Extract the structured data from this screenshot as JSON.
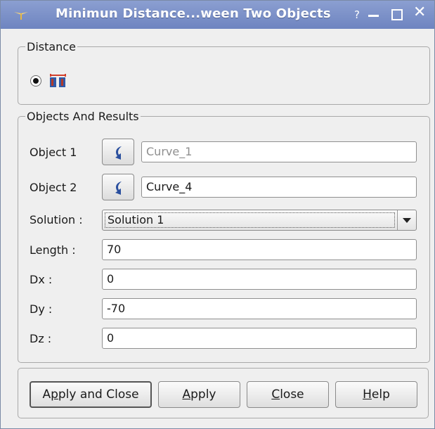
{
  "window": {
    "title": "Minimun Distance...ween Two Objects",
    "help_glyph": "?",
    "close_glyph": "✕"
  },
  "distance_group": {
    "label": "Distance",
    "option_icon": "two-objects-distance-icon"
  },
  "objects_group": {
    "label": "Objects And Results",
    "object1": {
      "label": "Object 1",
      "value": "Curve_1"
    },
    "object2": {
      "label": "Object 2",
      "value": "Curve_4"
    },
    "solution": {
      "label": "Solution :",
      "selected": "Solution 1"
    },
    "length": {
      "label": "Length :",
      "value": "70"
    },
    "dx": {
      "label": "Dx :",
      "value": "0"
    },
    "dy": {
      "label": "Dy :",
      "value": "-70"
    },
    "dz": {
      "label": "Dz :",
      "value": "0"
    }
  },
  "buttons": {
    "apply_close": {
      "pre": "A",
      "mn": "p",
      "post": "ply and Close"
    },
    "apply": {
      "pre": "",
      "mn": "A",
      "post": "pply"
    },
    "close": {
      "pre": "",
      "mn": "C",
      "post": "lose"
    },
    "help": {
      "pre": "",
      "mn": "H",
      "post": "elp"
    }
  },
  "colors": {
    "titlebar": "#7a8fc8",
    "window_bg": "#efefef",
    "arrow_icon": "#2a4f9e"
  }
}
